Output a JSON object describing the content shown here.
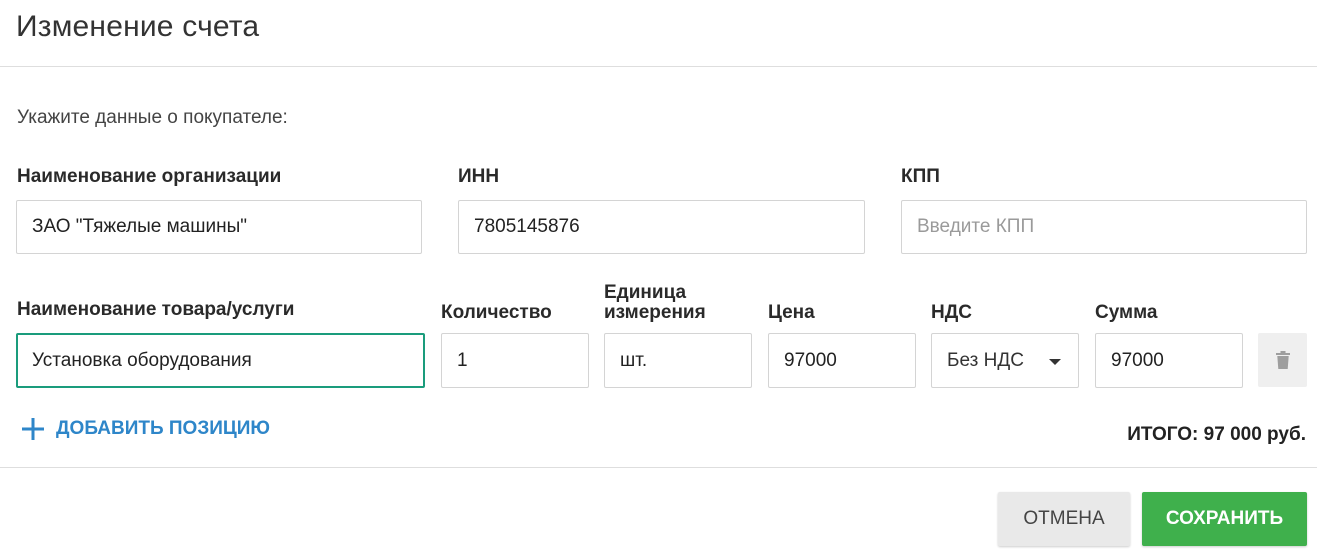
{
  "dialog": {
    "title": "Изменение счета",
    "intro": "Укажите данные о покупателе:"
  },
  "buyer": {
    "org_label": "Наименование организации",
    "org_value": "ЗАО \"Тяжелые машины\"",
    "inn_label": "ИНН",
    "inn_value": "7805145876",
    "kpp_label": "КПП",
    "kpp_value": "",
    "kpp_placeholder": "Введите КПП"
  },
  "items": {
    "headers": {
      "name": "Наименование товара/услуги",
      "qty": "Количество",
      "unit_line1": "Единица",
      "unit_line2": "измерения",
      "price": "Цена",
      "vat": "НДС",
      "sum": "Сумма"
    },
    "rows": [
      {
        "name": "Установка оборудования",
        "qty": "1",
        "unit": "шт.",
        "price": "97000",
        "vat": "Без НДС",
        "sum": "97000"
      }
    ],
    "add_label": "ДОБАВИТЬ ПОЗИЦИЮ",
    "total": "ИТОГО: 97 000 руб."
  },
  "actions": {
    "cancel": "ОТМЕНА",
    "save": "СОХРАНИТЬ"
  },
  "colors": {
    "accent": "#2e86c9",
    "focus": "#1a9c7c",
    "save": "#3fb04c"
  },
  "icons": {
    "add": "plus-icon",
    "delete": "trash-icon",
    "dropdown": "chevron-down-icon"
  }
}
